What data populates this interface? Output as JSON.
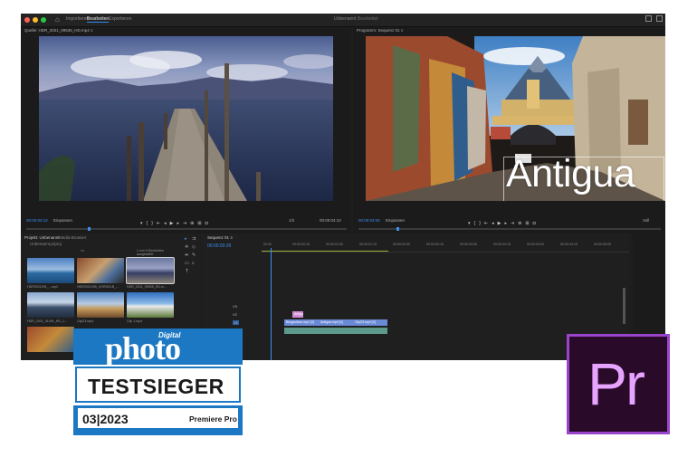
{
  "window": {
    "menu_home": "⌂",
    "menu_items": [
      "Importieren",
      "Bearbeiten",
      "Exportieren"
    ],
    "project_name": "Unbenannt",
    "project_status": "Bearbeitet"
  },
  "source_monitor": {
    "title": "Quelle: HDR_2021_09535_HD.mp4 ≡",
    "timecode": "00:00:00:12",
    "fit": "Einpassen",
    "zoom": "1/2",
    "duration": "00:00:04:12"
  },
  "program_monitor": {
    "title": "Programm: Sequenz 01 ≡",
    "timecode": "00:00:03:26",
    "fit": "Einpassen",
    "zoom": "Voll",
    "overlay_text": "Antigua"
  },
  "project_panel": {
    "tabs": [
      "Projekt: Unbenannt",
      "Media-Browser"
    ],
    "search_placeholder": "Unbenannt.prproj",
    "item_count": "1 von 6 Elementen ausgewählt",
    "thumbs": [
      {
        "label": "HDR2021091_...mp4"
      },
      {
        "label": "HDR2021095_VORGELB_..."
      },
      {
        "label": "HDR_2021_09535_HD.m..."
      },
      {
        "label": "HDR_2021_01091_HD_1..."
      },
      {
        "label": "Clip23.mp4"
      },
      {
        "label": "Clip 1.mp4"
      }
    ]
  },
  "timeline": {
    "title": "Sequenz 01 ≡",
    "timecode": "00:00:03:26",
    "ruler": [
      "00:00",
      "00:00:00:15",
      "00:00:01:00",
      "00:00:01:15",
      "00:00:02:00",
      "00:00:02:15",
      "00:00:03:00",
      "00:00:03:15",
      "00:00:04:00",
      "00:00:04:15",
      "00:00:05:00",
      "00:00:05:15"
    ],
    "tracks": [
      "V3",
      "V2",
      "V1",
      "A1",
      "A2",
      "A3"
    ],
    "title_clip": "Antigua",
    "v1_clips": [
      "Bergkulisse.mp4 [V]",
      "Antigua.mp4 [V]",
      "Clip23.mp4 [V]"
    ],
    "a1_clips": [
      "",
      "",
      ""
    ]
  },
  "badge": {
    "digital": "Digital",
    "photo": "photo",
    "title": "TESTSIEGER",
    "issue": "03|2023",
    "product": "Premiere Pro"
  },
  "logo": {
    "text": "Pr"
  }
}
